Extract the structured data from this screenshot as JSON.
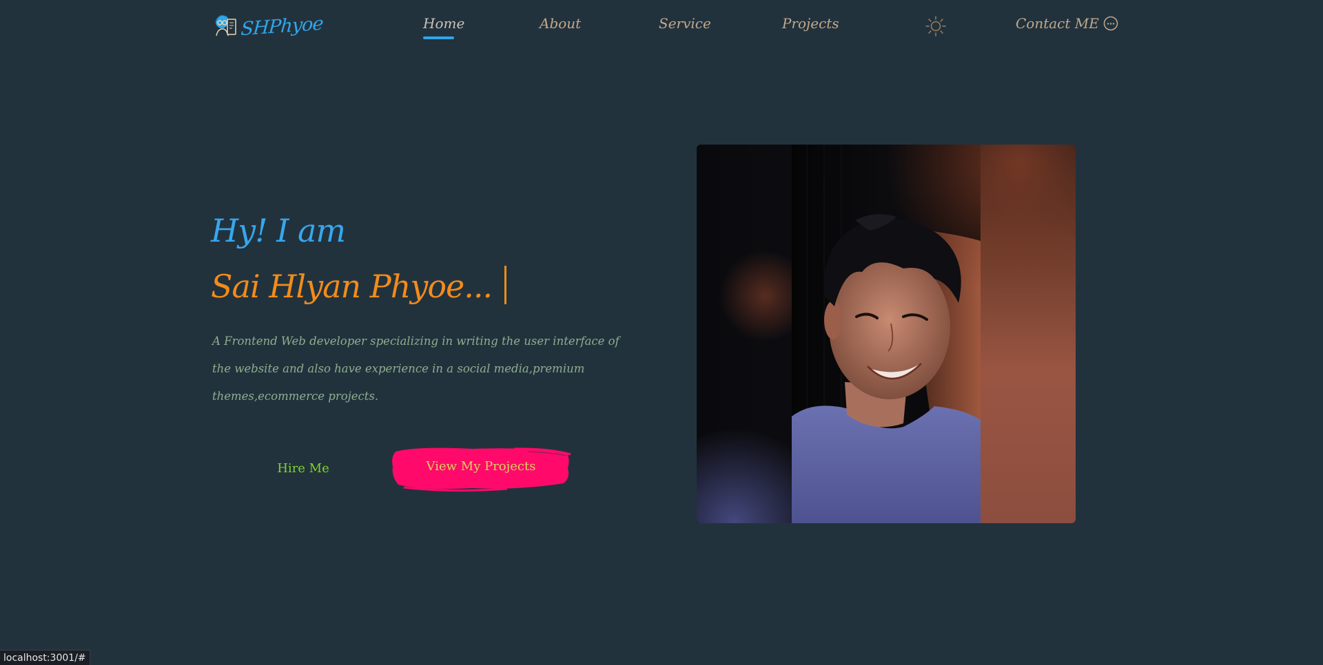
{
  "nav": {
    "logo_text": "SHPhyoe",
    "items": [
      {
        "label": "Home"
      },
      {
        "label": "About"
      },
      {
        "label": "Service"
      },
      {
        "label": "Projects"
      }
    ],
    "contact_label": "Contact ME"
  },
  "hero": {
    "greeting": "Hy!  I am",
    "name": "Sai Hlyan Phyoe...",
    "description": "A Frontend Web developer specializing in writing the user interface of the website and also have experience in a social media,premium themes,ecommerce projects.",
    "hire_label": "Hire Me",
    "projects_label": "View My Projects"
  },
  "status_bar": {
    "url": "localhost:3001/#"
  },
  "colors": {
    "background": "#22323d",
    "accent_blue": "#2fa6ea",
    "name_orange": "#f28c1a",
    "nav_text": "#c2a98b",
    "hire_green": "#7ed42a",
    "projects_pink": "#ff0a6a"
  },
  "icons": {
    "theme_toggle": "sun-icon",
    "contact": "chat-bubble-icon",
    "logo": "developer-avatar-icon"
  }
}
